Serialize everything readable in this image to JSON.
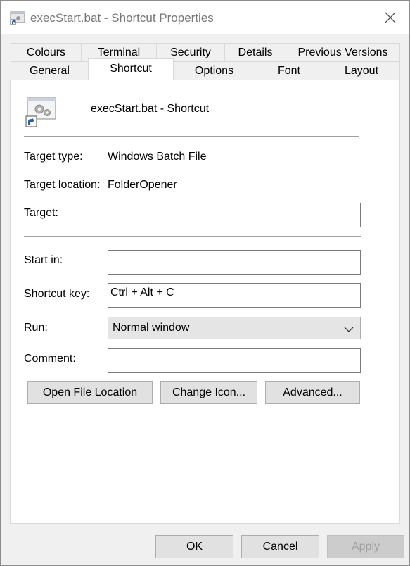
{
  "window": {
    "title": "execStart.bat - Shortcut Properties"
  },
  "tabs": {
    "row1": [
      "Colours",
      "Terminal",
      "Security",
      "Details",
      "Previous Versions"
    ],
    "row2": [
      "General",
      "Shortcut",
      "Options",
      "Font",
      "Layout"
    ],
    "active": "Shortcut"
  },
  "shortcut": {
    "name": "execStart.bat - Shortcut",
    "icon": "gear-shortcut-icon"
  },
  "fields": {
    "target_type_label": "Target type:",
    "target_type_value": "Windows Batch File",
    "target_location_label": "Target location:",
    "target_location_value": "FolderOpener",
    "target_label": "Target:",
    "target_value": "",
    "start_in_label": "Start in:",
    "start_in_value": "",
    "shortcut_key_label": "Shortcut key:",
    "shortcut_key_value": "Ctrl + Alt + C",
    "run_label": "Run:",
    "run_value": "Normal window",
    "comment_label": "Comment:",
    "comment_value": ""
  },
  "buttons": {
    "open_file_location": "Open File Location",
    "change_icon": "Change Icon...",
    "advanced": "Advanced...",
    "ok": "OK",
    "cancel": "Cancel",
    "apply": "Apply"
  },
  "colors": {
    "panel_bg": "#ffffff",
    "window_bg": "#f0f0f0",
    "disabled_text": "#a0a0a0"
  }
}
